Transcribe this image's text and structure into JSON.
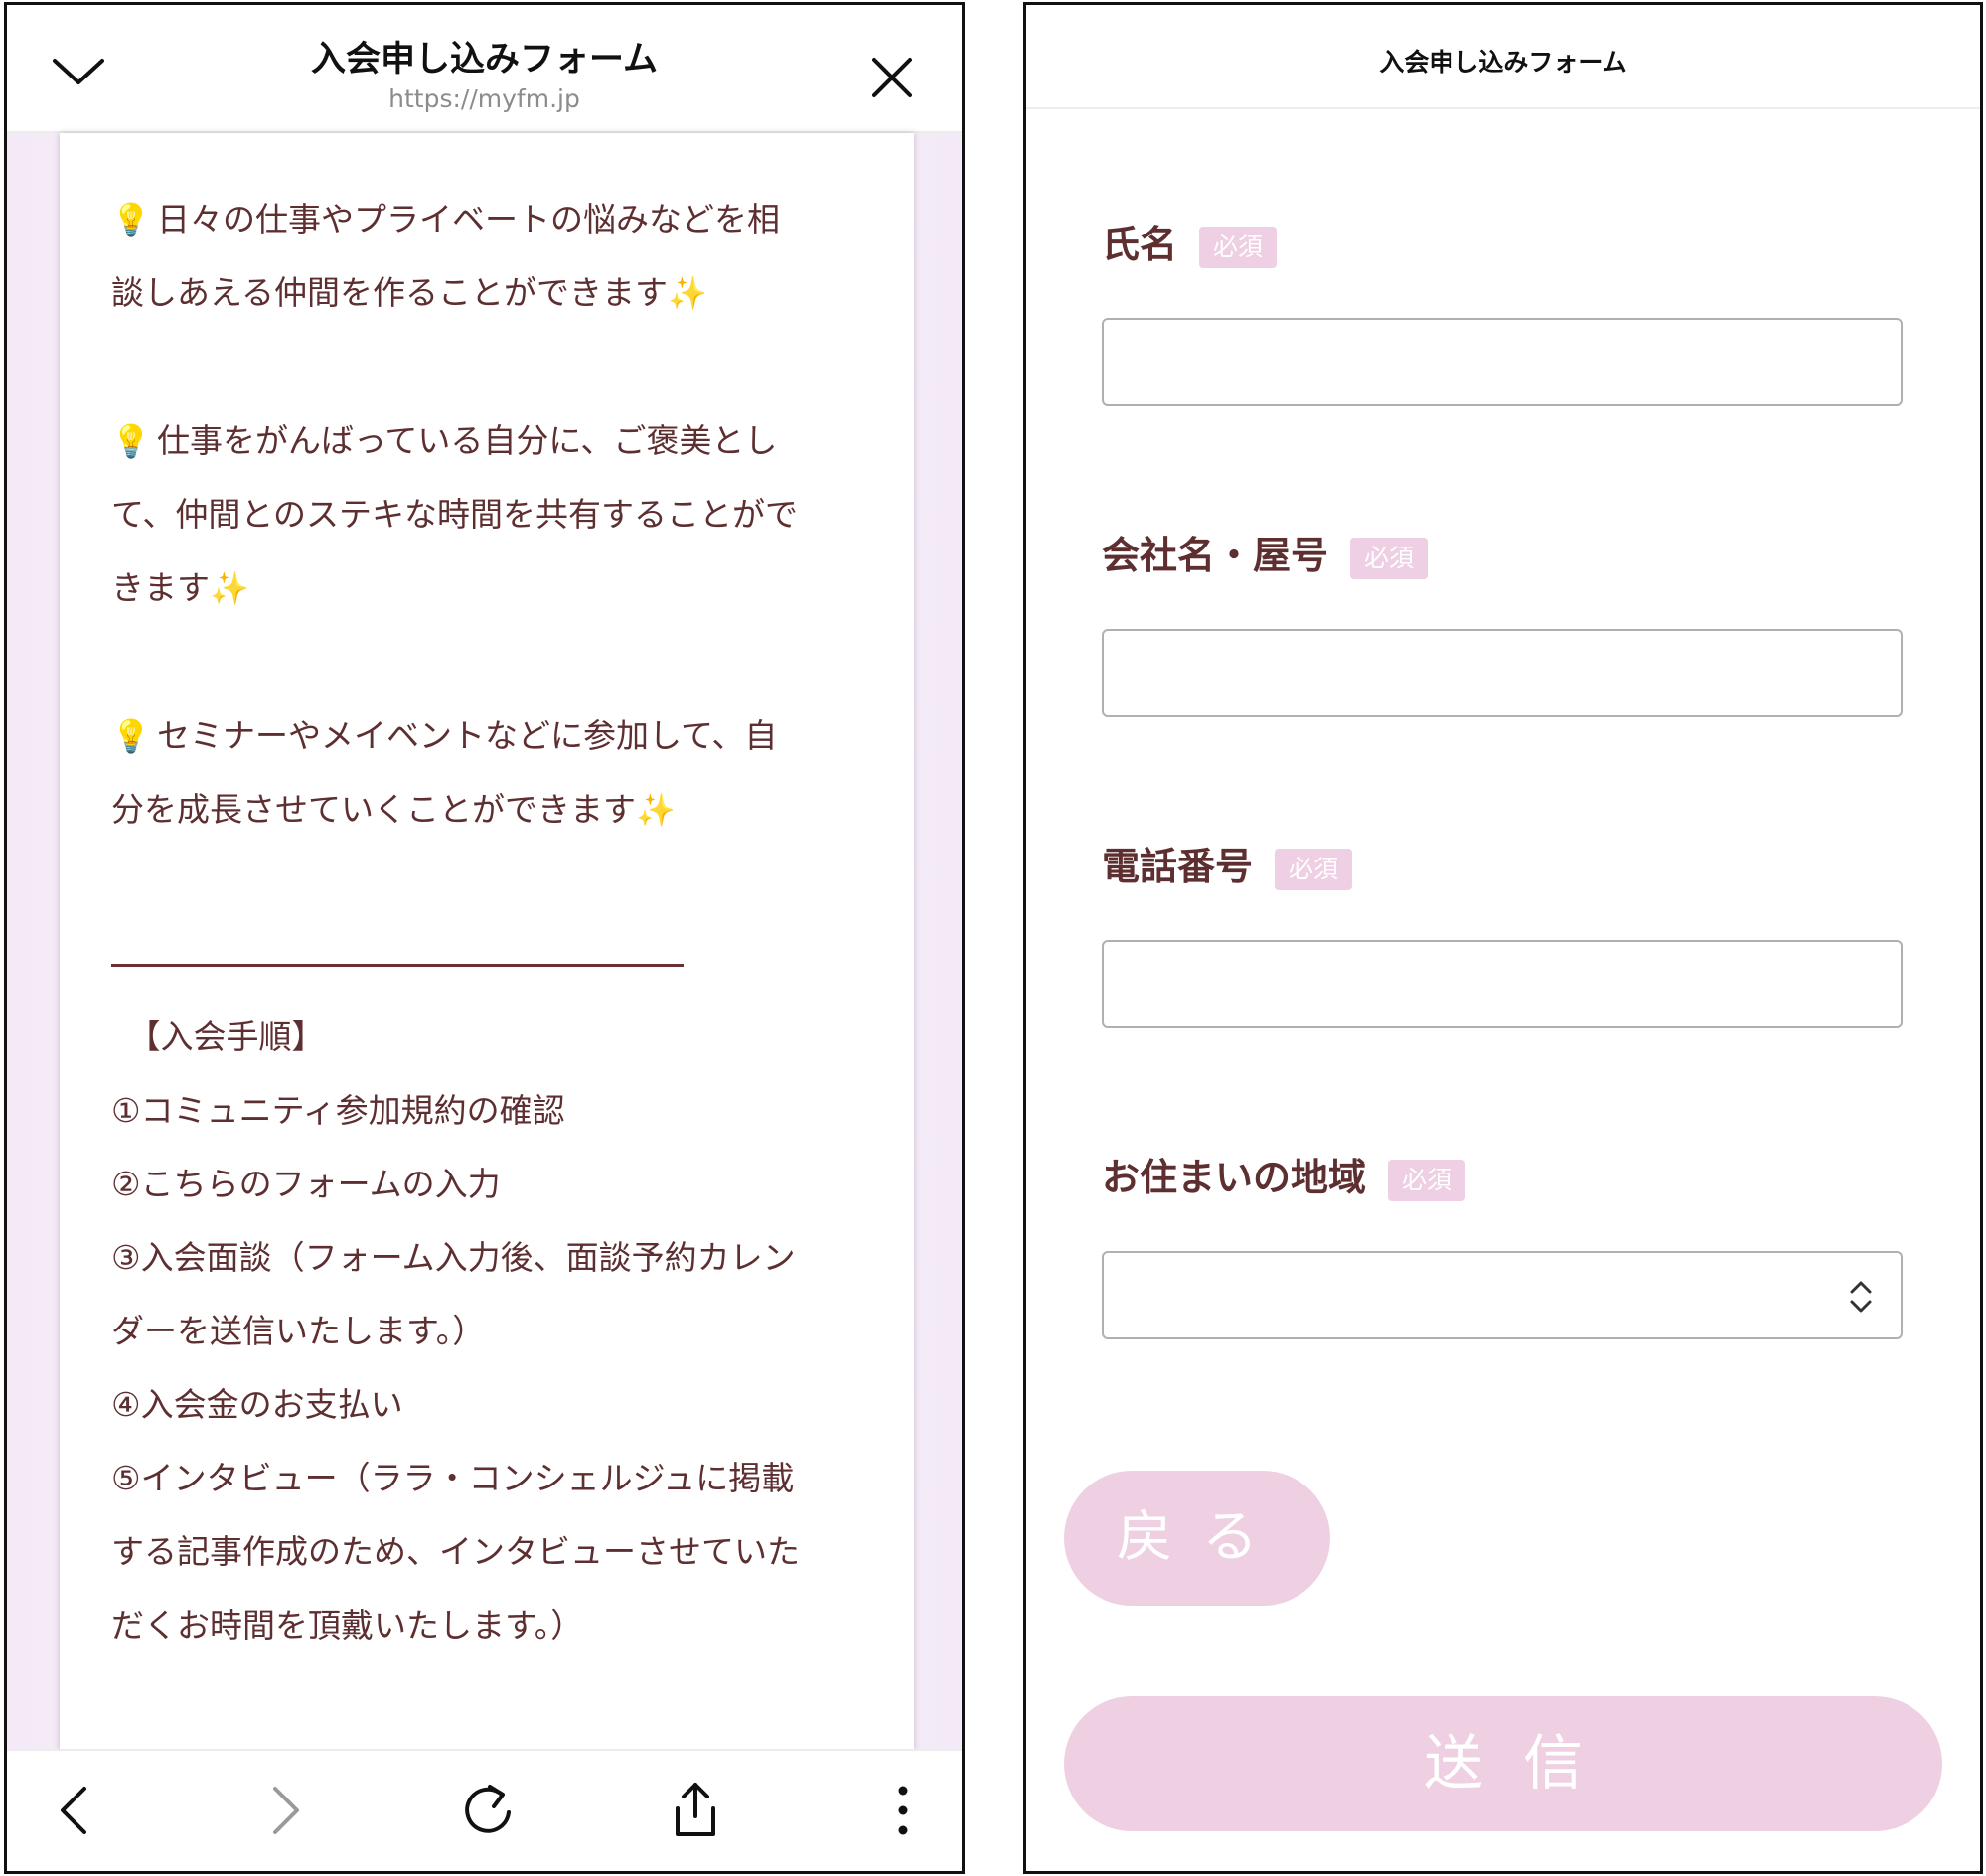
{
  "left": {
    "header": {
      "title": "入会申し込みフォーム",
      "url": "https://myfm.jp"
    },
    "icons": {
      "collapse": "chevron-down-icon",
      "close": "close-icon",
      "bulb": "lightbulb-icon",
      "sparkles": "sparkles-icon"
    },
    "bulb_glyph": "💡",
    "sparkle_glyph": "✨",
    "paragraphs": [
      [
        "日々の仕事やプライベートの悩みなどを相",
        "談しあえる仲間を作ることができます"
      ],
      [
        "仕事をがんばっている自分に、ご褒美とし",
        "て、仲間とのステキな時間を共有することがで",
        "きます"
      ],
      [
        "セミナーやメイベントなどに参加して、自",
        "分を成長させていくことができます"
      ]
    ],
    "steps_heading": "　【入会手順】",
    "steps": [
      "①コミュニティ参加規約の確認",
      "②こちらのフォームの入力",
      "③入会面談（フォーム入力後、面談予約カレン",
      "ダーを送信いたします。）",
      "④入会金のお支払い",
      "⑤インタビュー（ララ・コンシェルジュに掲載",
      "する記事作成のため、インタビューさせていた",
      "だくお時間を頂戴いたします。）"
    ],
    "nav": {
      "back": "back-arrow-icon",
      "forward": "forward-arrow-icon",
      "reload": "reload-icon",
      "share": "share-icon",
      "more": "more-vertical-icon"
    }
  },
  "right": {
    "header": {
      "title": "入会申し込みフォーム"
    },
    "required_badge": "必須",
    "fields": [
      {
        "label": "氏名",
        "value": ""
      },
      {
        "label": "会社名・屋号",
        "value": ""
      },
      {
        "label": "電話番号",
        "value": ""
      },
      {
        "label": "お住まいの地域",
        "value": ""
      }
    ],
    "buttons": {
      "back": "戻る",
      "submit": "送信"
    }
  },
  "colors": {
    "text": "#5e2f30",
    "badge": "#eecfe3",
    "button": "#efd0e2",
    "page_bg": "#f4eaf7"
  }
}
